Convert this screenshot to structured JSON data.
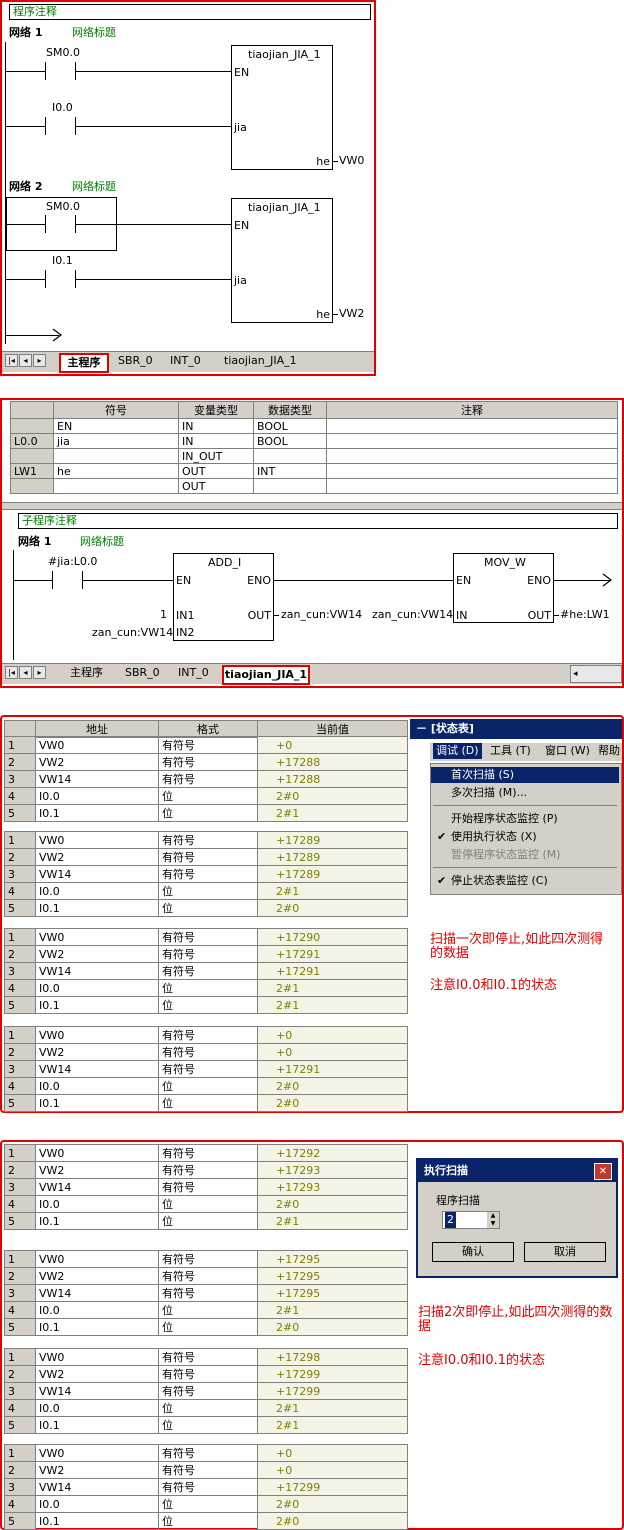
{
  "main": {
    "comment_header": "程序注释",
    "net1": {
      "label": "网络 1",
      "title": "网络标题",
      "c1": "SM0.0",
      "c2": "I0.0",
      "box": "tiaojian_JIA_1",
      "en": "EN",
      "jia": "jia",
      "he": "he",
      "out": "VW0"
    },
    "net2": {
      "label": "网络 2",
      "title": "网络标题",
      "c1": "SM0.0",
      "c2": "I0.1",
      "box": "tiaojian_JIA_1",
      "en": "EN",
      "jia": "jia",
      "he": "he",
      "out": "VW2"
    },
    "tabs": [
      "主程序",
      "SBR_0",
      "INT_0",
      "tiaojian_JIA_1"
    ]
  },
  "vartable": {
    "headers": [
      "符号",
      "变量类型",
      "数据类型",
      "注释"
    ],
    "rows": [
      {
        "addr": "",
        "sym": "EN",
        "vtype": "IN",
        "dtype": "BOOL"
      },
      {
        "addr": "L0.0",
        "sym": "jia",
        "vtype": "IN",
        "dtype": "BOOL"
      },
      {
        "addr": "",
        "sym": "",
        "vtype": "IN_OUT",
        "dtype": ""
      },
      {
        "addr": "LW1",
        "sym": "he",
        "vtype": "OUT",
        "dtype": "INT"
      },
      {
        "addr": "",
        "sym": "",
        "vtype": "OUT",
        "dtype": ""
      }
    ]
  },
  "sub": {
    "comment_header": "子程序注释",
    "net1": {
      "label": "网络 1",
      "title": "网络标题",
      "contact": "#jia:L0.0",
      "add": {
        "name": "ADD_I",
        "en": "EN",
        "eno": "ENO",
        "in1": "IN1",
        "in2": "IN2",
        "out": "OUT",
        "in1_val": "1",
        "in2_val": "zan_cun:VW14",
        "out_val": "zan_cun:VW14"
      },
      "mov": {
        "name": "MOV_W",
        "en": "EN",
        "eno": "ENO",
        "in": "IN",
        "out": "OUT",
        "in_val": "zan_cun:VW14",
        "out_val": "#he:LW1"
      }
    },
    "tabs": [
      "主程序",
      "SBR_0",
      "INT_0",
      "tiaojian_JIA_1"
    ]
  },
  "status1": {
    "headers": [
      "地址",
      "格式",
      "当前值"
    ],
    "groups": [
      [
        [
          "1",
          "VW0",
          "有符号",
          "+0"
        ],
        [
          "2",
          "VW2",
          "有符号",
          "+17288"
        ],
        [
          "3",
          "VW14",
          "有符号",
          "+17288"
        ],
        [
          "4",
          "I0.0",
          "位",
          "2#0"
        ],
        [
          "5",
          "I0.1",
          "位",
          "2#1"
        ]
      ],
      [
        [
          "1",
          "VW0",
          "有符号",
          "+17289"
        ],
        [
          "2",
          "VW2",
          "有符号",
          "+17289"
        ],
        [
          "3",
          "VW14",
          "有符号",
          "+17289"
        ],
        [
          "4",
          "I0.0",
          "位",
          "2#1"
        ],
        [
          "5",
          "I0.1",
          "位",
          "2#0"
        ]
      ],
      [
        [
          "1",
          "VW0",
          "有符号",
          "+17290"
        ],
        [
          "2",
          "VW2",
          "有符号",
          "+17291"
        ],
        [
          "3",
          "VW14",
          "有符号",
          "+17291"
        ],
        [
          "4",
          "I0.0",
          "位",
          "2#1"
        ],
        [
          "5",
          "I0.1",
          "位",
          "2#1"
        ]
      ],
      [
        [
          "1",
          "VW0",
          "有符号",
          "+0"
        ],
        [
          "2",
          "VW2",
          "有符号",
          "+0"
        ],
        [
          "3",
          "VW14",
          "有符号",
          "+17291"
        ],
        [
          "4",
          "I0.0",
          "位",
          "2#0"
        ],
        [
          "5",
          "I0.1",
          "位",
          "2#0"
        ]
      ]
    ],
    "panel_title": "－ [状态表]",
    "menubar": [
      "调试 (D)",
      "工具 (T)",
      "窗口 (W)",
      "帮助"
    ],
    "menu": [
      "首次扫描 (S)",
      "多次扫描 (M)...",
      "开始程序状态监控 (P)",
      "使用执行状态 (X)",
      "暂停程序状态监控 (M)",
      "停止状态表监控 (C)"
    ],
    "note1": "扫描一次即停止,如此四次测得的数据",
    "note2": "注意I0.0和I0.1的状态"
  },
  "status2": {
    "groups": [
      [
        [
          "1",
          "VW0",
          "有符号",
          "+17292"
        ],
        [
          "2",
          "VW2",
          "有符号",
          "+17293"
        ],
        [
          "3",
          "VW14",
          "有符号",
          "+17293"
        ],
        [
          "4",
          "I0.0",
          "位",
          "2#0"
        ],
        [
          "5",
          "I0.1",
          "位",
          "2#1"
        ]
      ],
      [
        [
          "1",
          "VW0",
          "有符号",
          "+17295"
        ],
        [
          "2",
          "VW2",
          "有符号",
          "+17295"
        ],
        [
          "3",
          "VW14",
          "有符号",
          "+17295"
        ],
        [
          "4",
          "I0.0",
          "位",
          "2#1"
        ],
        [
          "5",
          "I0.1",
          "位",
          "2#0"
        ]
      ],
      [
        [
          "1",
          "VW0",
          "有符号",
          "+17298"
        ],
        [
          "2",
          "VW2",
          "有符号",
          "+17299"
        ],
        [
          "3",
          "VW14",
          "有符号",
          "+17299"
        ],
        [
          "4",
          "I0.0",
          "位",
          "2#1"
        ],
        [
          "5",
          "I0.1",
          "位",
          "2#1"
        ]
      ],
      [
        [
          "1",
          "VW0",
          "有符号",
          "+0"
        ],
        [
          "2",
          "VW2",
          "有符号",
          "+0"
        ],
        [
          "3",
          "VW14",
          "有符号",
          "+17299"
        ],
        [
          "4",
          "I0.0",
          "位",
          "2#0"
        ],
        [
          "5",
          "I0.1",
          "位",
          "2#0"
        ]
      ]
    ],
    "dialog": {
      "title": "执行扫描",
      "label": "程序扫描",
      "value": "2",
      "ok": "确认",
      "cancel": "取消",
      "close": "✕"
    },
    "note1": "扫描2次即停止,如此四次测得的数据",
    "note2": "注意I0.0和I0.1的状态"
  }
}
